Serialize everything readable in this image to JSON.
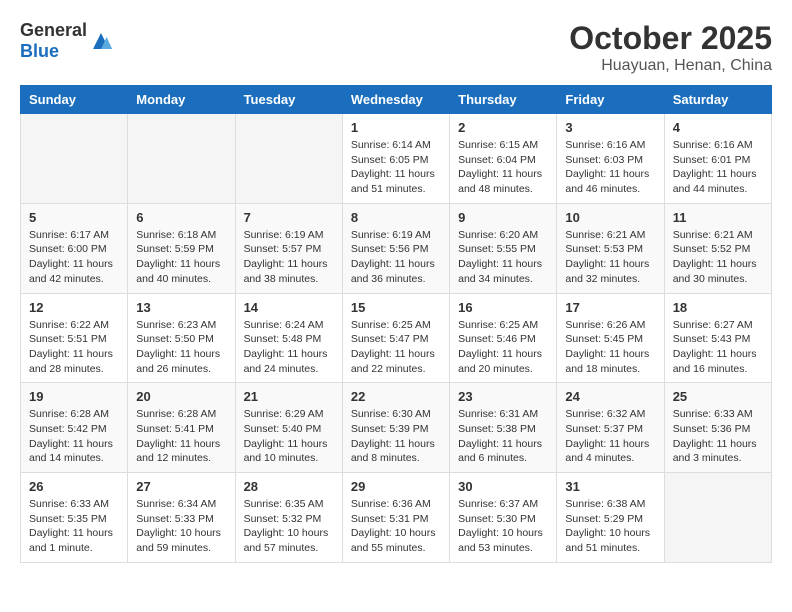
{
  "header": {
    "logo_general": "General",
    "logo_blue": "Blue",
    "month": "October 2025",
    "location": "Huayuan, Henan, China"
  },
  "weekdays": [
    "Sunday",
    "Monday",
    "Tuesday",
    "Wednesday",
    "Thursday",
    "Friday",
    "Saturday"
  ],
  "weeks": [
    [
      {
        "day": "",
        "info": ""
      },
      {
        "day": "",
        "info": ""
      },
      {
        "day": "",
        "info": ""
      },
      {
        "day": "1",
        "info": "Sunrise: 6:14 AM\nSunset: 6:05 PM\nDaylight: 11 hours\nand 51 minutes."
      },
      {
        "day": "2",
        "info": "Sunrise: 6:15 AM\nSunset: 6:04 PM\nDaylight: 11 hours\nand 48 minutes."
      },
      {
        "day": "3",
        "info": "Sunrise: 6:16 AM\nSunset: 6:03 PM\nDaylight: 11 hours\nand 46 minutes."
      },
      {
        "day": "4",
        "info": "Sunrise: 6:16 AM\nSunset: 6:01 PM\nDaylight: 11 hours\nand 44 minutes."
      }
    ],
    [
      {
        "day": "5",
        "info": "Sunrise: 6:17 AM\nSunset: 6:00 PM\nDaylight: 11 hours\nand 42 minutes."
      },
      {
        "day": "6",
        "info": "Sunrise: 6:18 AM\nSunset: 5:59 PM\nDaylight: 11 hours\nand 40 minutes."
      },
      {
        "day": "7",
        "info": "Sunrise: 6:19 AM\nSunset: 5:57 PM\nDaylight: 11 hours\nand 38 minutes."
      },
      {
        "day": "8",
        "info": "Sunrise: 6:19 AM\nSunset: 5:56 PM\nDaylight: 11 hours\nand 36 minutes."
      },
      {
        "day": "9",
        "info": "Sunrise: 6:20 AM\nSunset: 5:55 PM\nDaylight: 11 hours\nand 34 minutes."
      },
      {
        "day": "10",
        "info": "Sunrise: 6:21 AM\nSunset: 5:53 PM\nDaylight: 11 hours\nand 32 minutes."
      },
      {
        "day": "11",
        "info": "Sunrise: 6:21 AM\nSunset: 5:52 PM\nDaylight: 11 hours\nand 30 minutes."
      }
    ],
    [
      {
        "day": "12",
        "info": "Sunrise: 6:22 AM\nSunset: 5:51 PM\nDaylight: 11 hours\nand 28 minutes."
      },
      {
        "day": "13",
        "info": "Sunrise: 6:23 AM\nSunset: 5:50 PM\nDaylight: 11 hours\nand 26 minutes."
      },
      {
        "day": "14",
        "info": "Sunrise: 6:24 AM\nSunset: 5:48 PM\nDaylight: 11 hours\nand 24 minutes."
      },
      {
        "day": "15",
        "info": "Sunrise: 6:25 AM\nSunset: 5:47 PM\nDaylight: 11 hours\nand 22 minutes."
      },
      {
        "day": "16",
        "info": "Sunrise: 6:25 AM\nSunset: 5:46 PM\nDaylight: 11 hours\nand 20 minutes."
      },
      {
        "day": "17",
        "info": "Sunrise: 6:26 AM\nSunset: 5:45 PM\nDaylight: 11 hours\nand 18 minutes."
      },
      {
        "day": "18",
        "info": "Sunrise: 6:27 AM\nSunset: 5:43 PM\nDaylight: 11 hours\nand 16 minutes."
      }
    ],
    [
      {
        "day": "19",
        "info": "Sunrise: 6:28 AM\nSunset: 5:42 PM\nDaylight: 11 hours\nand 14 minutes."
      },
      {
        "day": "20",
        "info": "Sunrise: 6:28 AM\nSunset: 5:41 PM\nDaylight: 11 hours\nand 12 minutes."
      },
      {
        "day": "21",
        "info": "Sunrise: 6:29 AM\nSunset: 5:40 PM\nDaylight: 11 hours\nand 10 minutes."
      },
      {
        "day": "22",
        "info": "Sunrise: 6:30 AM\nSunset: 5:39 PM\nDaylight: 11 hours\nand 8 minutes."
      },
      {
        "day": "23",
        "info": "Sunrise: 6:31 AM\nSunset: 5:38 PM\nDaylight: 11 hours\nand 6 minutes."
      },
      {
        "day": "24",
        "info": "Sunrise: 6:32 AM\nSunset: 5:37 PM\nDaylight: 11 hours\nand 4 minutes."
      },
      {
        "day": "25",
        "info": "Sunrise: 6:33 AM\nSunset: 5:36 PM\nDaylight: 11 hours\nand 3 minutes."
      }
    ],
    [
      {
        "day": "26",
        "info": "Sunrise: 6:33 AM\nSunset: 5:35 PM\nDaylight: 11 hours\nand 1 minute."
      },
      {
        "day": "27",
        "info": "Sunrise: 6:34 AM\nSunset: 5:33 PM\nDaylight: 10 hours\nand 59 minutes."
      },
      {
        "day": "28",
        "info": "Sunrise: 6:35 AM\nSunset: 5:32 PM\nDaylight: 10 hours\nand 57 minutes."
      },
      {
        "day": "29",
        "info": "Sunrise: 6:36 AM\nSunset: 5:31 PM\nDaylight: 10 hours\nand 55 minutes."
      },
      {
        "day": "30",
        "info": "Sunrise: 6:37 AM\nSunset: 5:30 PM\nDaylight: 10 hours\nand 53 minutes."
      },
      {
        "day": "31",
        "info": "Sunrise: 6:38 AM\nSunset: 5:29 PM\nDaylight: 10 hours\nand 51 minutes."
      },
      {
        "day": "",
        "info": ""
      }
    ]
  ]
}
